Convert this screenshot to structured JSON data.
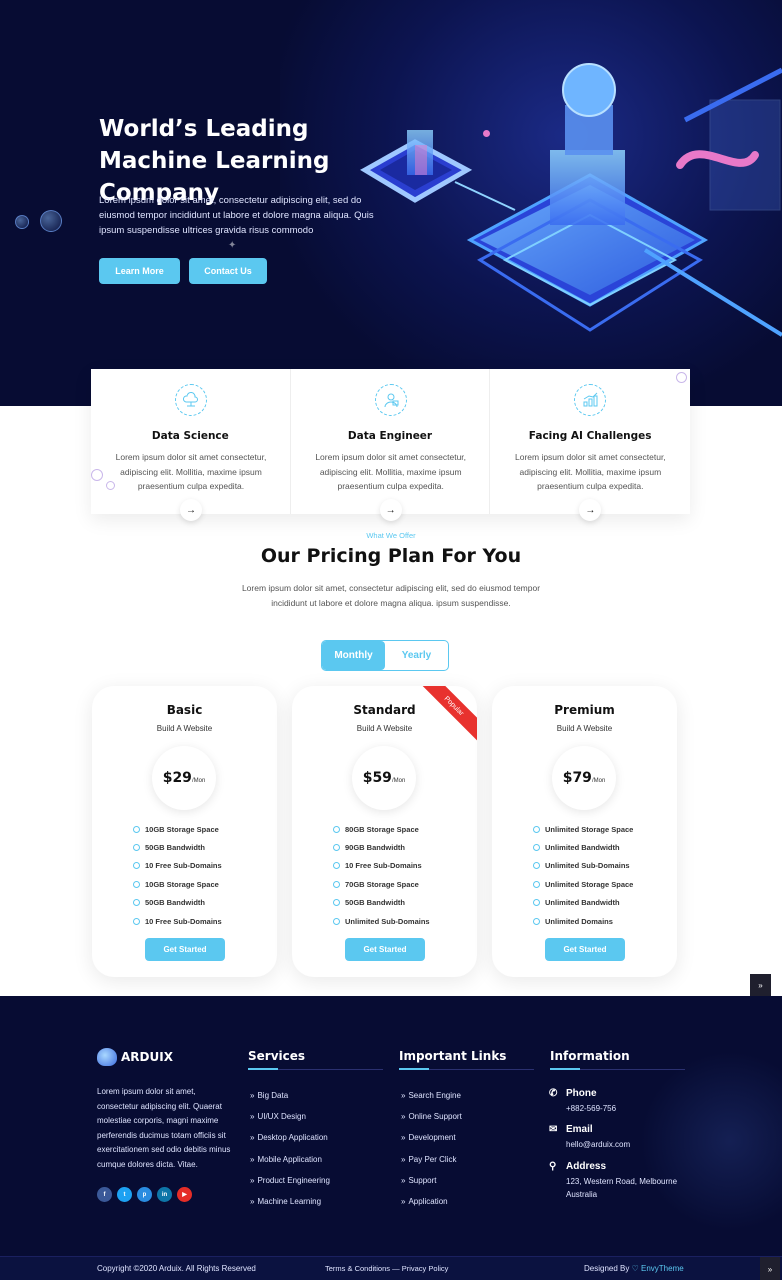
{
  "hero": {
    "title": "World’s Leading Machine Learning Company",
    "text": "Lorem ipsum dolor sit amet, consectetur adipiscing elit, sed do eiusmod tempor incididunt ut labore et dolore magna aliqua. Quis ipsum suspendisse ultrices gravida risus commodo",
    "learn_more": "Learn More",
    "contact_us": "Contact Us"
  },
  "features": [
    {
      "title": "Data Science",
      "text": "Lorem ipsum dolor sit amet consectetur, adipiscing elit. Mollitia, maxime ipsum praesentium culpa expedita.",
      "icon": "cloud-network-icon"
    },
    {
      "title": "Data Engineer",
      "text": "Lorem ipsum dolor sit amet consectetur, adipiscing elit. Mollitia, maxime ipsum praesentium culpa expedita.",
      "icon": "engineer-icon"
    },
    {
      "title": "Facing AI Challenges",
      "text": "Lorem ipsum dolor sit amet consectetur, adipiscing elit. Mollitia, maxime ipsum praesentium culpa expedita.",
      "icon": "chart-growth-icon"
    }
  ],
  "pricing": {
    "eyebrow": "What We Offer",
    "title": "Our Pricing Plan For You",
    "text": "Lorem ipsum dolor sit amet, consectetur adipiscing elit, sed do eiusmod tempor incididunt ut labore et dolore magna aliqua. ipsum suspendisse.",
    "toggle_monthly": "Monthly",
    "toggle_yearly": "Yearly",
    "accent": "#5bc8f0",
    "ribbon_color": "#e8322e",
    "plans": [
      {
        "name": "Basic",
        "sub": "Build A Website",
        "price": "$29",
        "per": "/Mon",
        "button": "Get Started",
        "items": [
          "10GB Storage Space",
          "50GB Bandwidth",
          "10 Free Sub-Domains",
          "10GB Storage Space",
          "50GB Bandwidth",
          "10 Free Sub-Domains"
        ]
      },
      {
        "name": "Standard",
        "sub": "Build A Website",
        "price": "$59",
        "per": "/Mon",
        "button": "Get Started",
        "ribbon": "Popular",
        "items": [
          "80GB Storage Space",
          "90GB Bandwidth",
          "10 Free Sub-Domains",
          "70GB Storage Space",
          "50GB Bandwidth",
          "Unlimited Sub-Domains"
        ]
      },
      {
        "name": "Premium",
        "sub": "Build A Website",
        "price": "$79",
        "per": "/Mon",
        "button": "Get Started",
        "items": [
          "Unlimited Storage Space",
          "Unlimited Bandwidth",
          "Unlimited Sub-Domains",
          "Unlimited Storage Space",
          "Unlimited Bandwidth",
          "Unlimited Domains"
        ]
      }
    ]
  },
  "footer": {
    "brand": "ARDUIX",
    "about": "Lorem ipsum dolor sit amet, consectetur adipiscing elit. Quaerat molestiae corporis, magni maxime perferendis ducimus totam officiis sit exercitationem sed odio debitis minus cumque dolores dicta. Vitae.",
    "socials": [
      {
        "icon": "facebook-icon",
        "glyph": "f",
        "color": "#3b5998"
      },
      {
        "icon": "twitter-icon",
        "glyph": "t",
        "color": "#1da1f2"
      },
      {
        "icon": "pinterest-icon",
        "glyph": "p",
        "color": "#2a8ce0"
      },
      {
        "icon": "linkedin-icon",
        "glyph": "in",
        "color": "#0e76a8"
      },
      {
        "icon": "youtube-icon",
        "glyph": "▶",
        "color": "#e52d27"
      }
    ],
    "services_title": "Services",
    "services": [
      "Big Data",
      "UI/UX Design",
      "Desktop Application",
      "Mobile Application",
      "Product Engineering",
      "Machine Learning"
    ],
    "links_title": "Important Links",
    "links": [
      "Search Engine",
      "Online Support",
      "Development",
      "Pay Per Click",
      "Support",
      "Application"
    ],
    "info_title": "Information",
    "phone_label": "Phone",
    "phone": "+882-569-756",
    "email_label": "Email",
    "email": "hello@arduix.com",
    "address_label": "Address",
    "address": "123, Western Road, Melbourne Australia",
    "copyright": "Copyright ©2020 Arduix. All Rights Reserved",
    "terms": "Terms & Conditions — Privacy Policy",
    "designed_by": "Designed By",
    "designer": "EnvyTheme"
  }
}
